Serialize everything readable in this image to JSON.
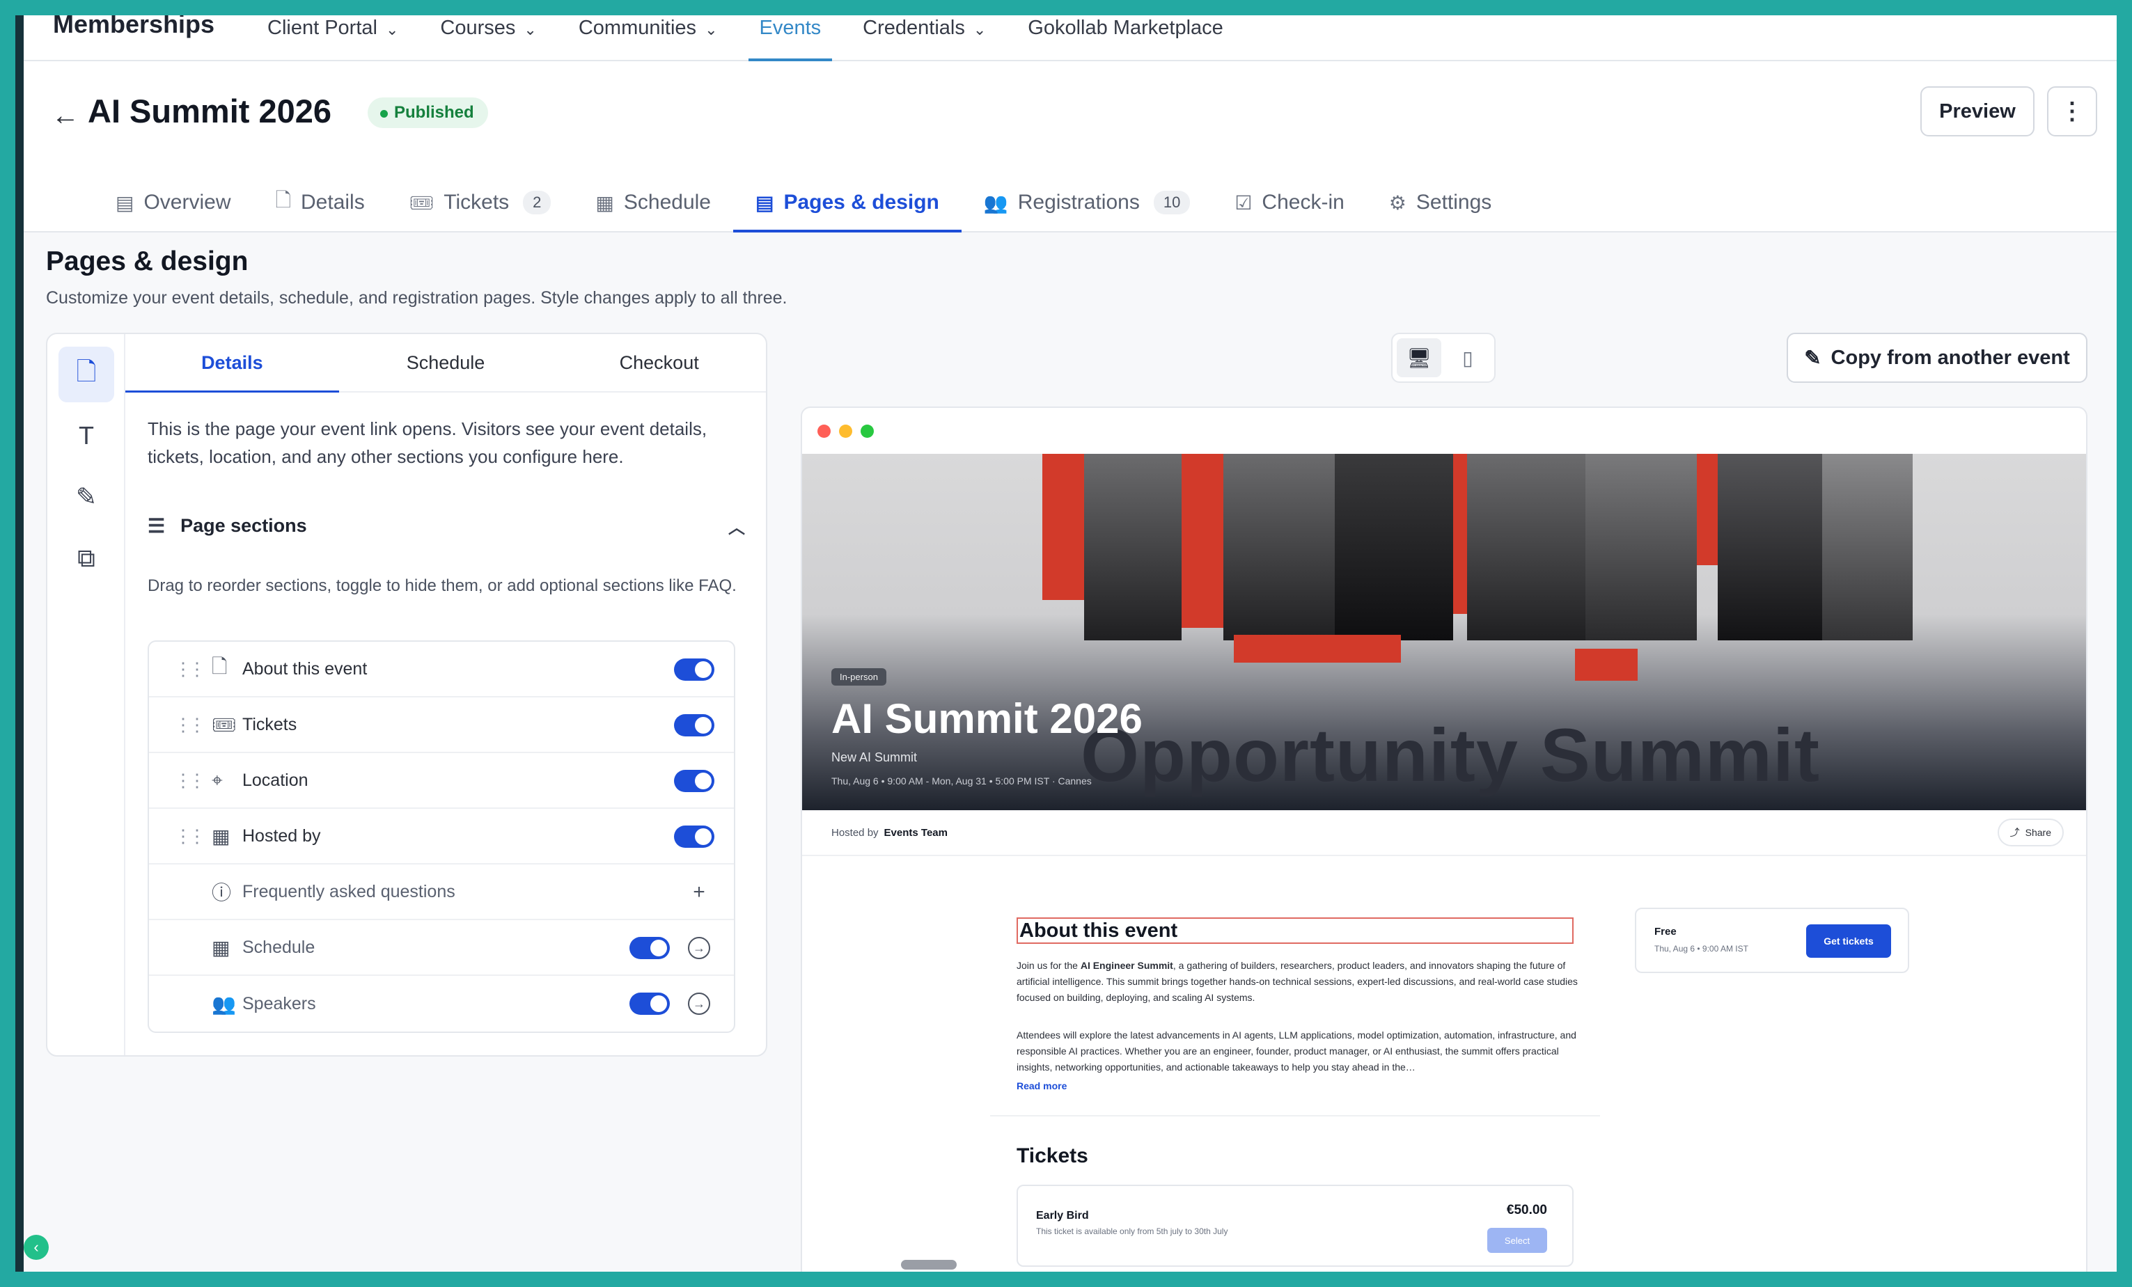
{
  "topnav": {
    "brand": "Memberships",
    "items": [
      {
        "label": "Client Portal",
        "has_menu": true
      },
      {
        "label": "Courses",
        "has_menu": true
      },
      {
        "label": "Communities",
        "has_menu": true
      },
      {
        "label": "Events",
        "has_menu": false,
        "active": true
      },
      {
        "label": "Credentials",
        "has_menu": true
      },
      {
        "label": "Gokollab Marketplace",
        "has_menu": false
      }
    ]
  },
  "header": {
    "title": "AI Summit 2026",
    "status": "Published",
    "preview_label": "Preview",
    "more_icon": "more-vertical-icon",
    "back_icon": "arrow-left-icon"
  },
  "tabs": [
    {
      "label": "Overview",
      "icon": "layout-icon"
    },
    {
      "label": "Details",
      "icon": "file-icon"
    },
    {
      "label": "Tickets",
      "icon": "ticket-icon",
      "count": "2"
    },
    {
      "label": "Schedule",
      "icon": "calendar-icon"
    },
    {
      "label": "Pages & design",
      "icon": "layout-icon",
      "active": true
    },
    {
      "label": "Registrations",
      "icon": "users-icon",
      "count": "10"
    },
    {
      "label": "Check-in",
      "icon": "check-square-icon"
    },
    {
      "label": "Settings",
      "icon": "gear-icon"
    }
  ],
  "page": {
    "heading": "Pages & design",
    "subheading": "Customize your event details, schedule, and registration pages. Style changes apply to all three."
  },
  "editor": {
    "rail": [
      "file-icon",
      "text-icon",
      "brush-icon",
      "code-icon"
    ],
    "subtabs": [
      "Details",
      "Schedule",
      "Checkout"
    ],
    "active_subtab": "Details",
    "intro": "This is the page your event link opens. Visitors see your event details, tickets, location, and any other sections you configure here.",
    "sections_title": "Page sections",
    "drag_hint": "Drag to reorder sections, toggle to hide them, or add optional sections like FAQ.",
    "sections": [
      {
        "label": "About this event",
        "icon": "file-icon",
        "draggable": true,
        "enabled": true
      },
      {
        "label": "Tickets",
        "icon": "ticket-icon",
        "draggable": true,
        "enabled": true
      },
      {
        "label": "Location",
        "icon": "map-pin-icon",
        "draggable": true,
        "enabled": true
      },
      {
        "label": "Hosted by",
        "icon": "building-icon",
        "draggable": true,
        "enabled": true
      },
      {
        "label": "Frequently asked questions",
        "icon": "help-circle-icon",
        "draggable": false,
        "addable": true
      },
      {
        "label": "Schedule",
        "icon": "calendar-icon",
        "draggable": false,
        "enabled": true,
        "navigable": true
      },
      {
        "label": "Speakers",
        "icon": "users-icon",
        "draggable": false,
        "enabled": true,
        "navigable": true
      }
    ]
  },
  "preview_controls": {
    "device_desktop": "monitor-icon",
    "device_mobile": "smartphone-icon",
    "copy_label": "Copy from another event"
  },
  "preview": {
    "chip": "In-person",
    "title": "AI Summit 2026",
    "subtitle": "New AI Summit",
    "when": "Thu, Aug 6 • 9:00 AM - Mon, Aug 31 • 5:00 PM IST · Cannes",
    "banner_word": "Opportunity Summit",
    "hosted_by_label": "Hosted by",
    "hosted_by": "Events Team",
    "share_label": "Share",
    "about_heading": "About this event",
    "about_p1_pre": "Join us for the ",
    "about_p1_bold": "AI Engineer Summit",
    "about_p1_post": ", a gathering of builders, researchers, product leaders, and innovators shaping the future of artificial intelligence. This summit brings together hands-on technical sessions, expert-led discussions, and real-world case studies focused on building, deploying, and scaling AI systems.",
    "about_p2": "Attendees will explore the latest advancements in AI agents, LLM applications, model optimization, automation, infrastructure, and responsible AI practices. Whether you are an engineer, founder, product manager, or AI enthusiast, the summit offers practical insights, networking opportunities, and actionable takeaways to help you stay ahead in the…",
    "read_more": "Read more",
    "tickets_heading": "Tickets",
    "ticket": {
      "name": "Early Bird",
      "desc": "This ticket is available only from 5th july to 30th July",
      "price": "€50.00",
      "select": "Select"
    },
    "side": {
      "price": "Free",
      "date": "Thu, Aug 6 • 9:00 AM IST",
      "cta": "Get tickets"
    }
  },
  "colors": {
    "accent": "#1d4ed8",
    "nav_active": "#3388c7",
    "published": "#15803d",
    "frame": "#23a9a2"
  }
}
